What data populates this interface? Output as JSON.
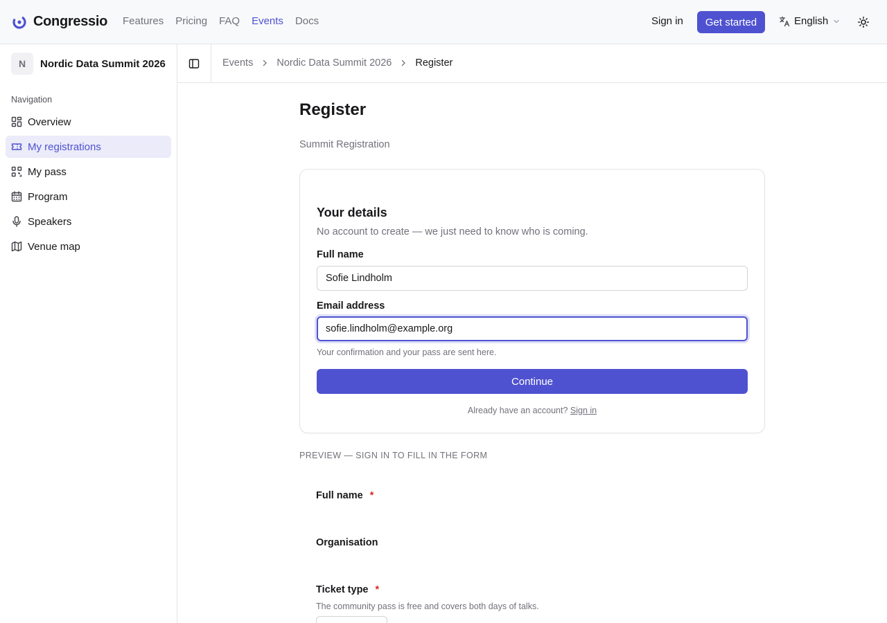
{
  "header": {
    "brand": "Congressio",
    "nav": [
      {
        "label": "Features",
        "active": false
      },
      {
        "label": "Pricing",
        "active": false
      },
      {
        "label": "FAQ",
        "active": false
      },
      {
        "label": "Events",
        "active": true
      },
      {
        "label": "Docs",
        "active": false
      }
    ],
    "sign_in": "Sign in",
    "get_started": "Get started",
    "language": "English",
    "icons": {
      "logo": "logo-icon",
      "language": "translate-icon",
      "language_chevron": "chevron-down-icon",
      "theme": "sun-icon"
    }
  },
  "sidebar": {
    "event_initial": "N",
    "event_name": "Nordic Data Summit 2026",
    "section_label": "Navigation",
    "items": [
      {
        "label": "Overview",
        "icon": "dashboard-icon",
        "active": false
      },
      {
        "label": "My registrations",
        "icon": "ticket-icon",
        "active": true
      },
      {
        "label": "My pass",
        "icon": "qr-code-icon",
        "active": false
      },
      {
        "label": "Program",
        "icon": "calendar-icon",
        "active": false
      },
      {
        "label": "Speakers",
        "icon": "microphone-icon",
        "active": false
      },
      {
        "label": "Venue map",
        "icon": "map-icon",
        "active": false
      }
    ]
  },
  "breadcrumb": {
    "toggle_icon": "sidebar-toggle-icon",
    "items": [
      "Events",
      "Nordic Data Summit 2026",
      "Register"
    ]
  },
  "main": {
    "title": "Register",
    "subtitle": "Summit Registration",
    "details_card": {
      "title": "Your details",
      "description": "No account to create — we just need to know who is coming.",
      "full_name_label": "Full name",
      "full_name_value": "Sofie Lindholm",
      "email_label": "Email address",
      "email_value": "sofie.lindholm@example.org",
      "email_hint": "Your confirmation and your pass are sent here.",
      "continue_label": "Continue",
      "already_text": "Already have an account?",
      "sign_in_link": "Sign in"
    },
    "preview": {
      "label": "PREVIEW — SIGN IN TO FILL IN THE FORM",
      "fields": [
        {
          "label": "Full name",
          "required": "*"
        },
        {
          "label": "Organisation"
        },
        {
          "label": "Ticket type",
          "required": "*",
          "hint": "The community pass is free and covers both days of talks."
        }
      ]
    }
  },
  "colors": {
    "accent": "#4f52d0",
    "active_bg": "#ebebfa",
    "required": "#dc2626"
  }
}
